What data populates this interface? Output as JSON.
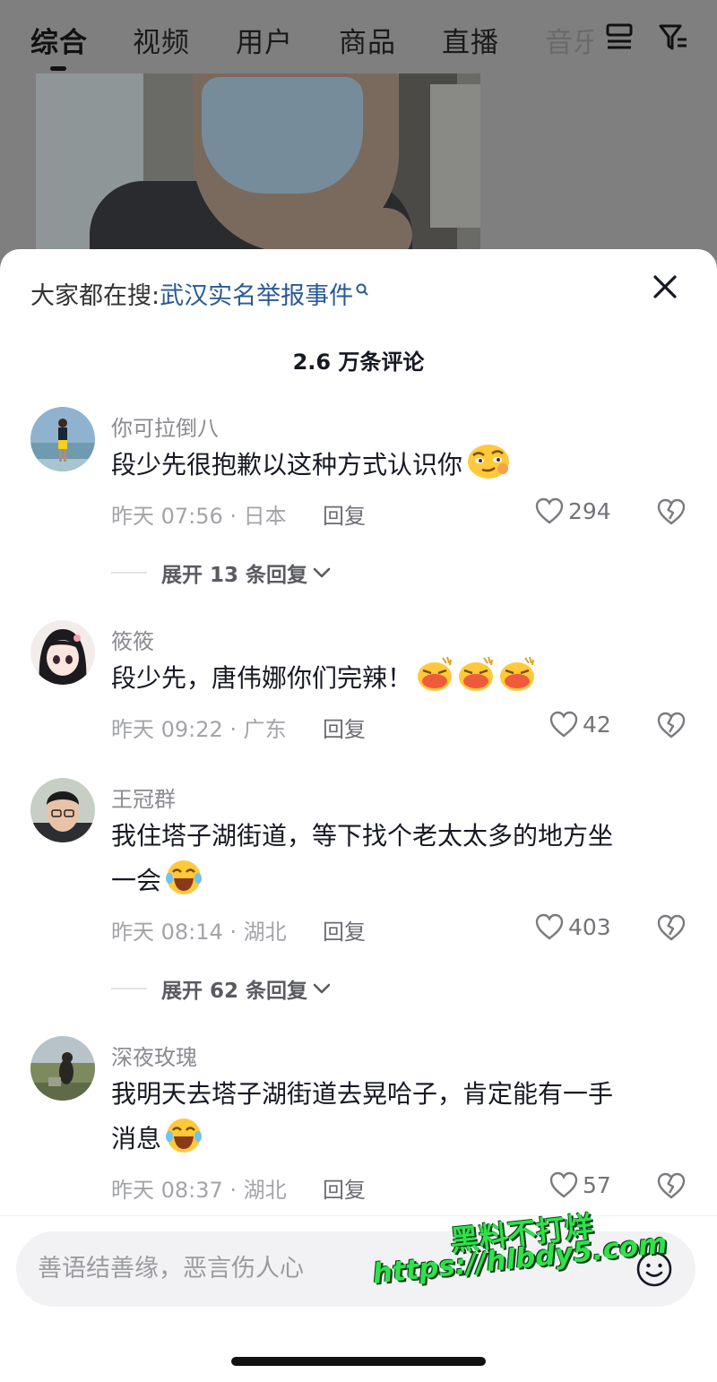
{
  "top_tabs": [
    {
      "label": "综合",
      "active": true
    },
    {
      "label": "视频"
    },
    {
      "label": "用户"
    },
    {
      "label": "商品"
    },
    {
      "label": "直播"
    },
    {
      "label": "音乐",
      "partial": true
    }
  ],
  "top_icons": [
    "list-icon",
    "filter-icon"
  ],
  "sheet": {
    "search_prefix": "大家都在搜:",
    "search_term": "武汉实名举报事件",
    "comment_count": "2.6 万条评论"
  },
  "comments": [
    {
      "username": "你可拉倒八",
      "text": "段少先很抱歉以这种方式认识你",
      "emoji": [
        "smirk-emoji-icon"
      ],
      "time": "昨天 07:56 · 日本",
      "reply_label": "回复",
      "likes": "294",
      "expand": "展开 13 条回复"
    },
    {
      "username": "筱筱",
      "text": "段少先，唐伟娜你们完辣！",
      "emoji": [
        "angry-emoji-icon",
        "angry-emoji-icon",
        "angry-emoji-icon"
      ],
      "time": "昨天 09:22 · 广东",
      "reply_label": "回复",
      "likes": "42"
    },
    {
      "username": "王冠群",
      "text_line1": "我住塔子湖街道，等下找个老太太多的地方坐",
      "text_line2": "一会",
      "emoji": [
        "crying-laughing-emoji-icon"
      ],
      "time": "昨天 08:14 · 湖北",
      "reply_label": "回复",
      "likes": "403",
      "expand": "展开 62 条回复"
    },
    {
      "username": "深夜玫瑰",
      "text_line1": "我明天去塔子湖街道去晃哈子，肯定能有一手",
      "text_line2": "消息",
      "emoji": [
        "crying-laughing-emoji-icon"
      ],
      "time": "昨天 08:37 · 湖北",
      "reply_label": "回复",
      "likes": "57"
    }
  ],
  "input": {
    "placeholder": "善语结善缘，恶言伤人心"
  },
  "watermark": {
    "title": "黑料不打烊",
    "url": "https://hlbdy5.com"
  },
  "colors": {
    "link": "#2a5a96",
    "muted": "#a3a4a8",
    "username": "#8a8b91",
    "watermark": "#2fe24a"
  }
}
